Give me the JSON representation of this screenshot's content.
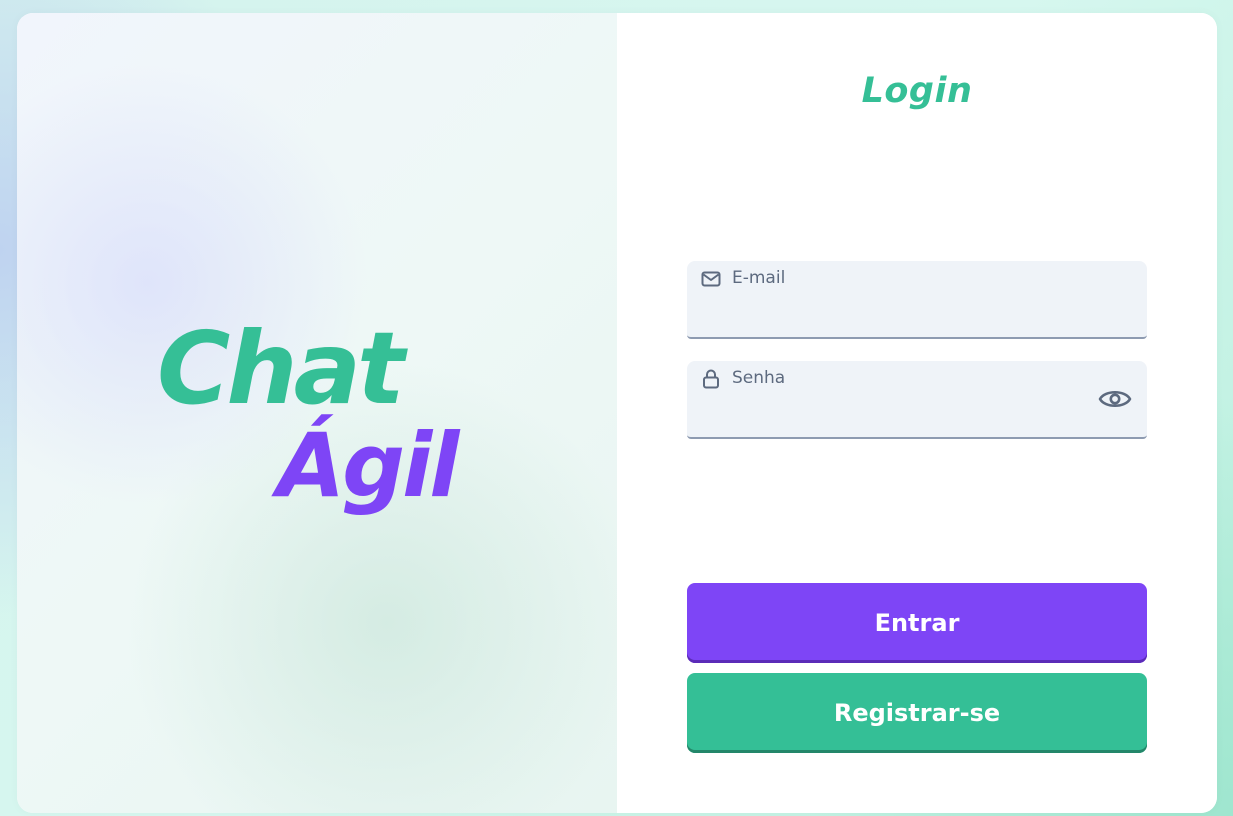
{
  "brand": {
    "logo_text_line1": "Chat",
    "logo_text_line2": "Ágil",
    "primary_color": "#34bf96",
    "accent_color": "#7e45f6"
  },
  "login": {
    "title": "Login",
    "email": {
      "label": "E-mail",
      "value": "",
      "icon": "mail-icon"
    },
    "password": {
      "label": "Senha",
      "value": "",
      "icon": "lock-icon",
      "toggle_icon": "eye-icon"
    },
    "submit_label": "Entrar",
    "register_label": "Registrar-se"
  }
}
